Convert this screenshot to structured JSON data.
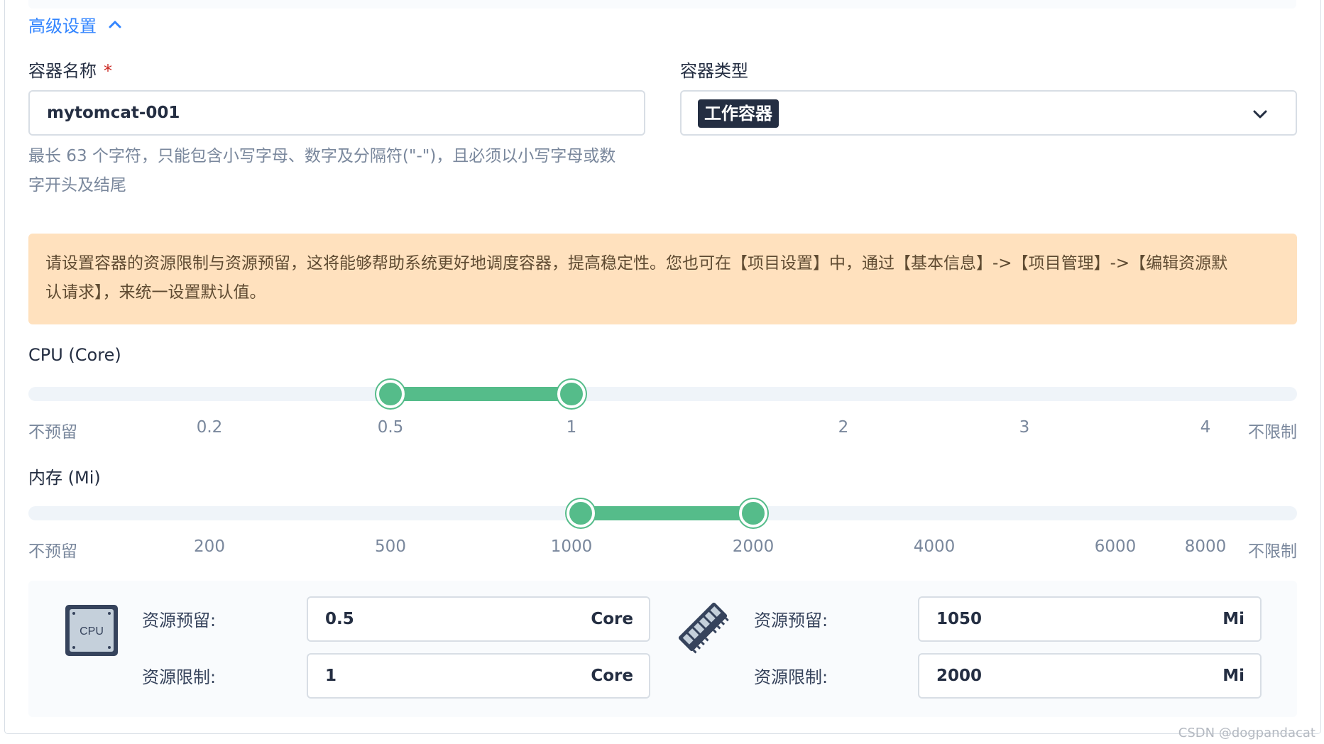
{
  "advanced": {
    "toggle_label": "高级设置",
    "toggle_icon": "chevron-up-icon"
  },
  "container_name": {
    "label": "容器名称",
    "required_mark": "*",
    "value": "mytomcat-001",
    "hint_line1": "最长 63 个字符，只能包含小写字母、数字及分隔符(\"-\")，且必须以小写字母或数",
    "hint_line2": "字开头及结尾"
  },
  "container_type": {
    "label": "容器类型",
    "selected": "工作容器",
    "dropdown_icon": "chevron-down-icon"
  },
  "notice": {
    "line1": "请设置容器的资源限制与资源预留，这将能够帮助系统更好地调度容器，提高稳定性。您也可在【项目设置】中，通过【基本信息】->【项目管理】->【编辑资源默",
    "line2": "认请求】，来统一设置默认值。"
  },
  "cpu_slider": {
    "label": "CPU (Core)",
    "ticks": [
      "不预留",
      "0.2",
      "0.5",
      "1",
      "2",
      "3",
      "4",
      "不限制"
    ],
    "reservation": "0.5",
    "limit": "1"
  },
  "memory_slider": {
    "label": "内存 (Mi)",
    "ticks": [
      "不预留",
      "200",
      "500",
      "1000",
      "2000",
      "4000",
      "6000",
      "8000",
      "不限制"
    ],
    "reservation": "1000",
    "limit": "2000"
  },
  "cpu_resources": {
    "icon_text": "CPU",
    "reservation_label": "资源预留:",
    "reservation_value": "0.5",
    "limit_label": "资源限制:",
    "limit_value": "1",
    "unit": "Core"
  },
  "memory_resources": {
    "icon": "memory-icon",
    "reservation_label": "资源预留:",
    "reservation_value": "1050",
    "limit_label": "资源限制:",
    "limit_value": "2000",
    "unit": "Mi"
  },
  "watermark": "CSDN @dogpandacat",
  "colors": {
    "accent": "#3385ff",
    "slider_fill": "#55bc8a",
    "notice_bg": "#ffe1be",
    "required": "#ca2621"
  }
}
